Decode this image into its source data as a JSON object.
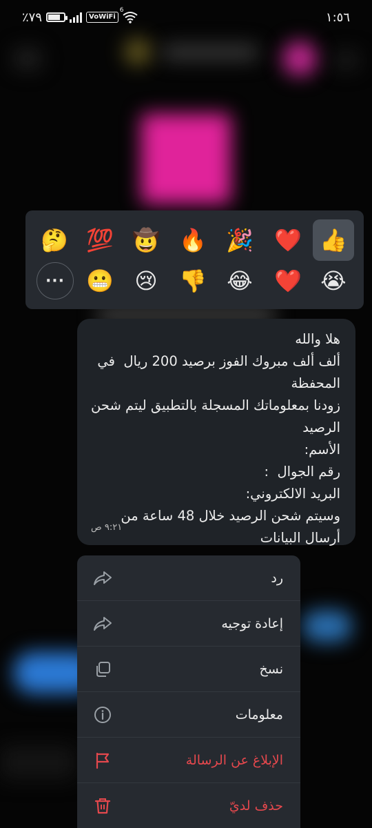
{
  "status_bar": {
    "time": "١:٥٦",
    "battery": "٪٧٩",
    "battery_level": 0.79,
    "vowifi": "VoWiFi",
    "wifi_badge": "6"
  },
  "reactions": {
    "row1": [
      {
        "emoji": "👍",
        "name": "thumbs-up",
        "selected": true
      },
      {
        "emoji": "❤️",
        "name": "red-heart"
      },
      {
        "emoji": "🎉",
        "name": "party-popper"
      },
      {
        "emoji": "🔥",
        "name": "fire"
      },
      {
        "emoji": "🤠",
        "name": "cowboy"
      },
      {
        "emoji": "💯",
        "name": "hundred-points"
      },
      {
        "emoji": "🤔",
        "name": "thinking-face"
      }
    ],
    "row2": [
      {
        "emoji": "😭",
        "name": "loudly-crying"
      },
      {
        "emoji": "❤️",
        "name": "heart"
      },
      {
        "emoji": "😂",
        "name": "tears-of-joy"
      },
      {
        "emoji": "👎",
        "name": "thumbs-down"
      },
      {
        "emoji": "😢",
        "name": "crying-face"
      },
      {
        "emoji": "😬",
        "name": "grimacing-face"
      }
    ],
    "more_label": "···"
  },
  "message": {
    "text": "هلا والله\nألف ألف مبروك الفوز برصيد 200 ريال  في المحفظة\nزودنا بمعلوماتك المسجلة بالتطبيق ليتم شحن الرصيد\nالأسم:\nرقم الجوال  :\nالبريد الالكتروني:\nوسيتم شحن الرصيد خلال 48 ساعة من أرسال البيانات",
    "time": "٩:٢١ ص"
  },
  "menu": {
    "items": [
      {
        "label": "رد",
        "icon": "reply-icon",
        "danger": false
      },
      {
        "label": "إعادة توجيه",
        "icon": "forward-icon",
        "danger": false
      },
      {
        "label": "نسخ",
        "icon": "copy-icon",
        "danger": false
      },
      {
        "label": "معلومات",
        "icon": "info-icon",
        "danger": false
      },
      {
        "label": "الإبلاغ عن الرسالة",
        "icon": "flag-icon",
        "danger": true
      },
      {
        "label": "حذف لديّ",
        "icon": "trash-icon",
        "danger": true
      }
    ]
  },
  "colors": {
    "danger": "#e5484d",
    "panel": "#262a30",
    "bubble": "#1f2328"
  }
}
